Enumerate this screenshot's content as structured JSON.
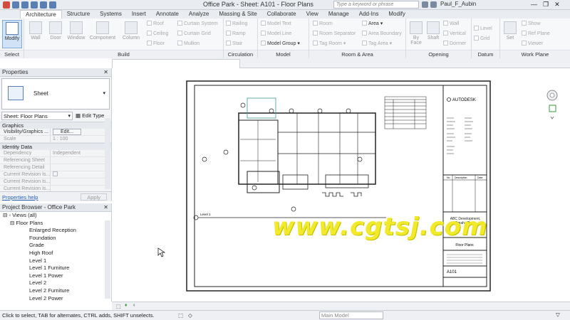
{
  "window": {
    "title": "Office Park - Sheet: A101 - Floor Plans",
    "search_placeholder": "Type a keyword or phrase",
    "user": "Paul_F_Aubin"
  },
  "ribbon": {
    "tabs": [
      "Architecture",
      "Structure",
      "Systems",
      "Insert",
      "Annotate",
      "Analyze",
      "Massing & Site",
      "Collaborate",
      "View",
      "Manage",
      "Add-Ins",
      "Modify"
    ],
    "active_tab": "Architecture",
    "modify_label": "Modify",
    "panels": {
      "select": "Select",
      "build": "Build",
      "circulation": "Circulation",
      "model": "Model",
      "room_area": "Room & Area",
      "opening": "Opening",
      "datum": "Datum",
      "work_plane": "Work Plane"
    },
    "build_big": [
      "Wall",
      "Door",
      "Window",
      "Component",
      "Column"
    ],
    "build_small": [
      "Roof",
      "Ceiling",
      "Floor",
      "Curtain System",
      "Curtain Grid",
      "Mullion"
    ],
    "circulation_small": [
      "Railing",
      "Ramp",
      "Stair"
    ],
    "model_small": [
      "Model Text",
      "Model Line",
      "Model Group"
    ],
    "room_small": [
      "Room",
      "Room Separator",
      "Tag Room",
      "Area",
      "Area Boundary",
      "Tag Area"
    ],
    "opening_big": [
      "By Face",
      "Shaft"
    ],
    "opening_small": [
      "Wall",
      "Vertical",
      "Dormer"
    ],
    "datum_small": [
      "Level",
      "Grid"
    ],
    "workplane_big": "Set",
    "workplane_small": [
      "Show",
      "Ref Plane",
      "Viewer"
    ]
  },
  "properties": {
    "header": "Properties",
    "type_name": "Sheet",
    "instance": "Sheet: Floor Plans",
    "edit_type": "Edit Type",
    "groups": [
      "Graphics",
      "Identity Data"
    ],
    "rows": [
      {
        "key": "Visibility/Graphics ...",
        "value": "Edit..."
      },
      {
        "key": "Scale",
        "value": "1 : 100"
      },
      {
        "key": "Dependency",
        "value": "Independent"
      },
      {
        "key": "Referencing Sheet",
        "value": ""
      },
      {
        "key": "Referencing Detail",
        "value": ""
      },
      {
        "key": "Current Revision Is...",
        "value": ""
      },
      {
        "key": "Current Revision Is...",
        "value": ""
      },
      {
        "key": "Current Revision Is...",
        "value": ""
      }
    ],
    "help_link": "Properties help",
    "apply": "Apply"
  },
  "browser": {
    "header": "Project Browser - Office Park",
    "views_all": "Views (all)",
    "floor_plans": "Floor Plans",
    "items": [
      "Enlarged Reception",
      "Foundation",
      "Grade",
      "High Roof",
      "Level 1",
      "Level 1 Furniture",
      "Level 1 Power",
      "Level 2",
      "Level 2 Furniture",
      "Level 2 Power"
    ]
  },
  "sheet": {
    "brand": "AUTODESK",
    "client": "ABC Development, Omaha/Reps",
    "sheet_title": "Floor Plans",
    "sheet_number": "A101",
    "level_label": "Level 1",
    "revision_headers": [
      "No.",
      "Description",
      "Date"
    ]
  },
  "status": {
    "message": "Click to select, TAB for alternates, CTRL adds, SHIFT unselects.",
    "view_scale": "1 : 100",
    "model": "Main Model"
  },
  "watermark": "www.cgtsj.com"
}
